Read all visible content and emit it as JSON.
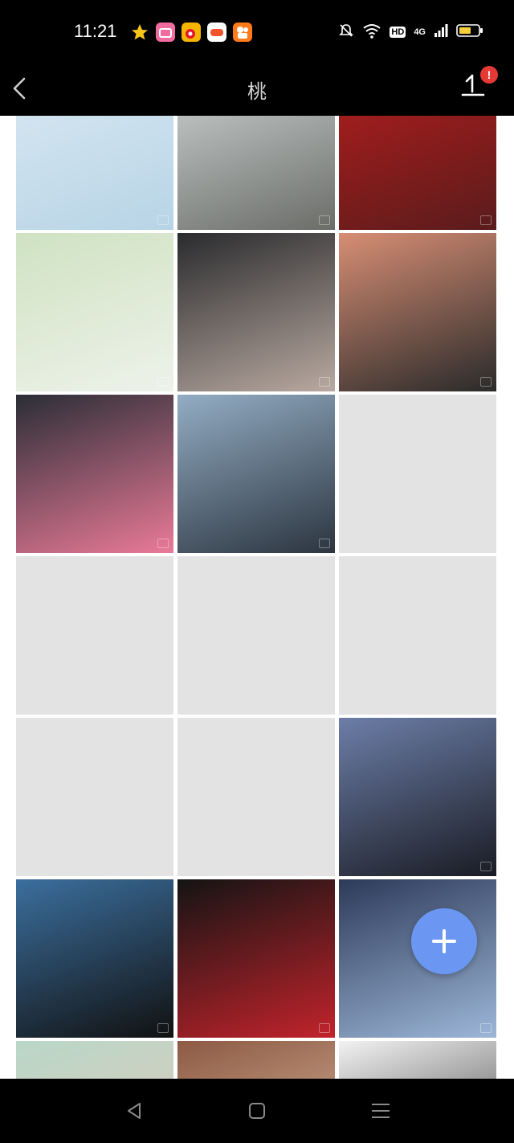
{
  "status_bar": {
    "time": "11:21",
    "network": "4G",
    "hd": "HD",
    "icons": [
      "star-app-icon",
      "bilibili-app-icon",
      "weibo-app-icon",
      "game-app-icon",
      "kuaishou-app-icon",
      "mute-bell-icon",
      "wifi-icon",
      "signal-icon",
      "battery-icon"
    ]
  },
  "nav": {
    "title": "桃",
    "alert_badge": "!"
  },
  "gallery": {
    "tiles": [
      {
        "type": "photo",
        "colors": [
          "#d9e8f2",
          "#b7d4e6"
        ]
      },
      {
        "type": "photo",
        "colors": [
          "#cfd3d4",
          "#6a6d68"
        ]
      },
      {
        "type": "photo",
        "colors": [
          "#b21d1d",
          "#5a1c1c"
        ]
      },
      {
        "type": "photo",
        "colors": [
          "#cfe2c2",
          "#eef2ea"
        ]
      },
      {
        "type": "photo",
        "colors": [
          "#2a2b2e",
          "#b9a9a0"
        ]
      },
      {
        "type": "photo",
        "colors": [
          "#d78e74",
          "#2a2a2a"
        ]
      },
      {
        "type": "photo",
        "colors": [
          "#2a2e36",
          "#ea7a98"
        ]
      },
      {
        "type": "photo",
        "colors": [
          "#93adc4",
          "#2c3540"
        ]
      },
      {
        "type": "empty"
      },
      {
        "type": "empty"
      },
      {
        "type": "empty"
      },
      {
        "type": "empty"
      },
      {
        "type": "empty"
      },
      {
        "type": "empty"
      },
      {
        "type": "photo",
        "colors": [
          "#6c7ea8",
          "#1a1c24"
        ]
      },
      {
        "type": "photo",
        "colors": [
          "#3b6f9e",
          "#111111"
        ]
      },
      {
        "type": "photo",
        "colors": [
          "#141414",
          "#c2232b"
        ]
      },
      {
        "type": "photo",
        "colors": [
          "#2d3a5a",
          "#9db7d8"
        ]
      },
      {
        "type": "photo",
        "colors": [
          "#b9d7c8",
          "#e4c7b7"
        ]
      },
      {
        "type": "photo",
        "colors": [
          "#8d5a44",
          "#e3c2a6"
        ]
      },
      {
        "type": "photo",
        "colors": [
          "#f2f2f2",
          "#2a2a2a"
        ]
      }
    ]
  },
  "fab": {
    "icon": "plus-icon",
    "color": "#6b97f2"
  },
  "system_nav": {
    "icons": [
      "back-triangle-icon",
      "home-square-icon",
      "menu-lines-icon"
    ]
  },
  "colors": {
    "accent": "#6b97f2",
    "badge": "#e53935",
    "placeholder": "#e3e3e3"
  }
}
